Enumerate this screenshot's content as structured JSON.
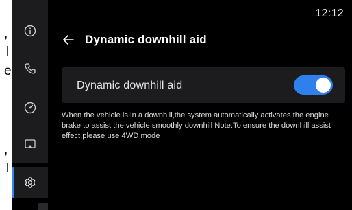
{
  "status_bar": {
    "time": "12:12"
  },
  "background_fragments": [
    ",",
    "l",
    "e",
    ",",
    "l"
  ],
  "sidebar": {
    "items": [
      {
        "icon": "info-icon",
        "active": false
      },
      {
        "icon": "phone-icon",
        "active": false
      },
      {
        "icon": "gauge-icon",
        "active": false
      },
      {
        "icon": "screen-cast-icon",
        "active": false
      },
      {
        "icon": "gear-icon",
        "active": true
      }
    ],
    "accent_color": "#3a82f7"
  },
  "header": {
    "back_icon": "back-arrow-icon",
    "title": "Dynamic downhill aid"
  },
  "setting": {
    "label": "Dynamic downhill aid",
    "toggle_on": true,
    "toggle_color": "#2f80ed"
  },
  "description": "When the vehicle is in a downhill,the system automatically activates the engine brake to assist the vehicle smoothly downhill Note:To ensure the downhill assist effect,please use 4WD mode"
}
